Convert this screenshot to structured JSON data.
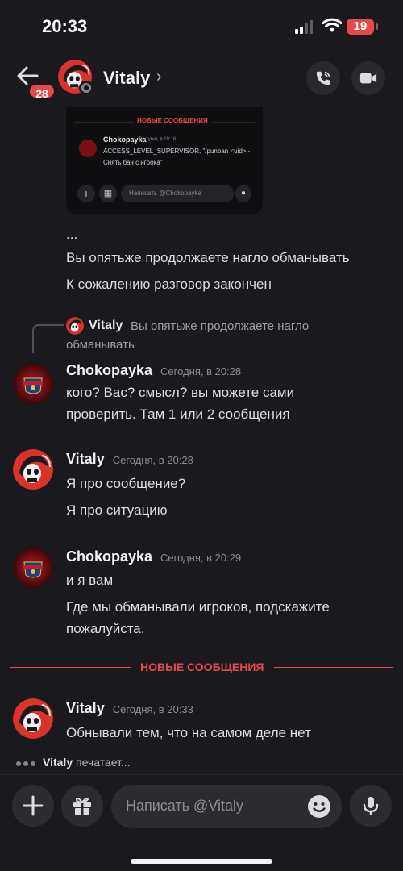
{
  "status_bar": {
    "time": "20:33",
    "battery": "19"
  },
  "header": {
    "back_badge": "28",
    "contact_name": "Vitaly",
    "chevron": "›"
  },
  "embedded_screenshot": {
    "divider_label": "НОВЫЕ СООБЩЕНИЯ",
    "author": "Chokopayka",
    "time": "Сегодня, в 19:16",
    "text": "ACCESS_LEVEL_SUPERVISOR, \"/punban <uid> - Снять бан с игрока\"",
    "placeholder": "Написать @Chokopayka"
  },
  "messages": [
    {
      "text": "..."
    },
    {
      "text": "Вы опятьже продолжаете нагло обманывать"
    },
    {
      "text": "К сожалению разговор закончен"
    }
  ],
  "reply": {
    "author": "Vitaly",
    "text_line1": "Вы опятьже продолжаете нагло",
    "text_line2": "обманывать"
  },
  "groups": [
    {
      "author": "Chokopayka",
      "time": "Сегодня, в 20:28",
      "lines": [
        "кого? Вас? смысл? вы можете сами",
        "проверить. Там 1 или 2 сообщения"
      ]
    },
    {
      "author": "Vitaly",
      "time": "Сегодня, в 20:28",
      "lines": [
        "Я про сообщение?",
        "Я про ситуацию"
      ]
    },
    {
      "author": "Chokopayka",
      "time": "Сегодня, в 20:29",
      "lines": [
        "и я вам",
        "Где мы обманывали игроков, подскажите",
        "пожалуйста."
      ]
    },
    {
      "author": "Vitaly",
      "time": "Сегодня, в 20:33",
      "lines": [
        "Обнывали тем, что на самом деле нет"
      ]
    }
  ],
  "new_messages_label": "НОВЫЕ СООБЩЕНИЯ",
  "typing": {
    "user": "Vitaly",
    "suffix": "печатает..."
  },
  "composer": {
    "placeholder": "Написать @Vitaly"
  },
  "colors": {
    "accent_red": "#e5484d",
    "background": "#1a1a1e"
  }
}
